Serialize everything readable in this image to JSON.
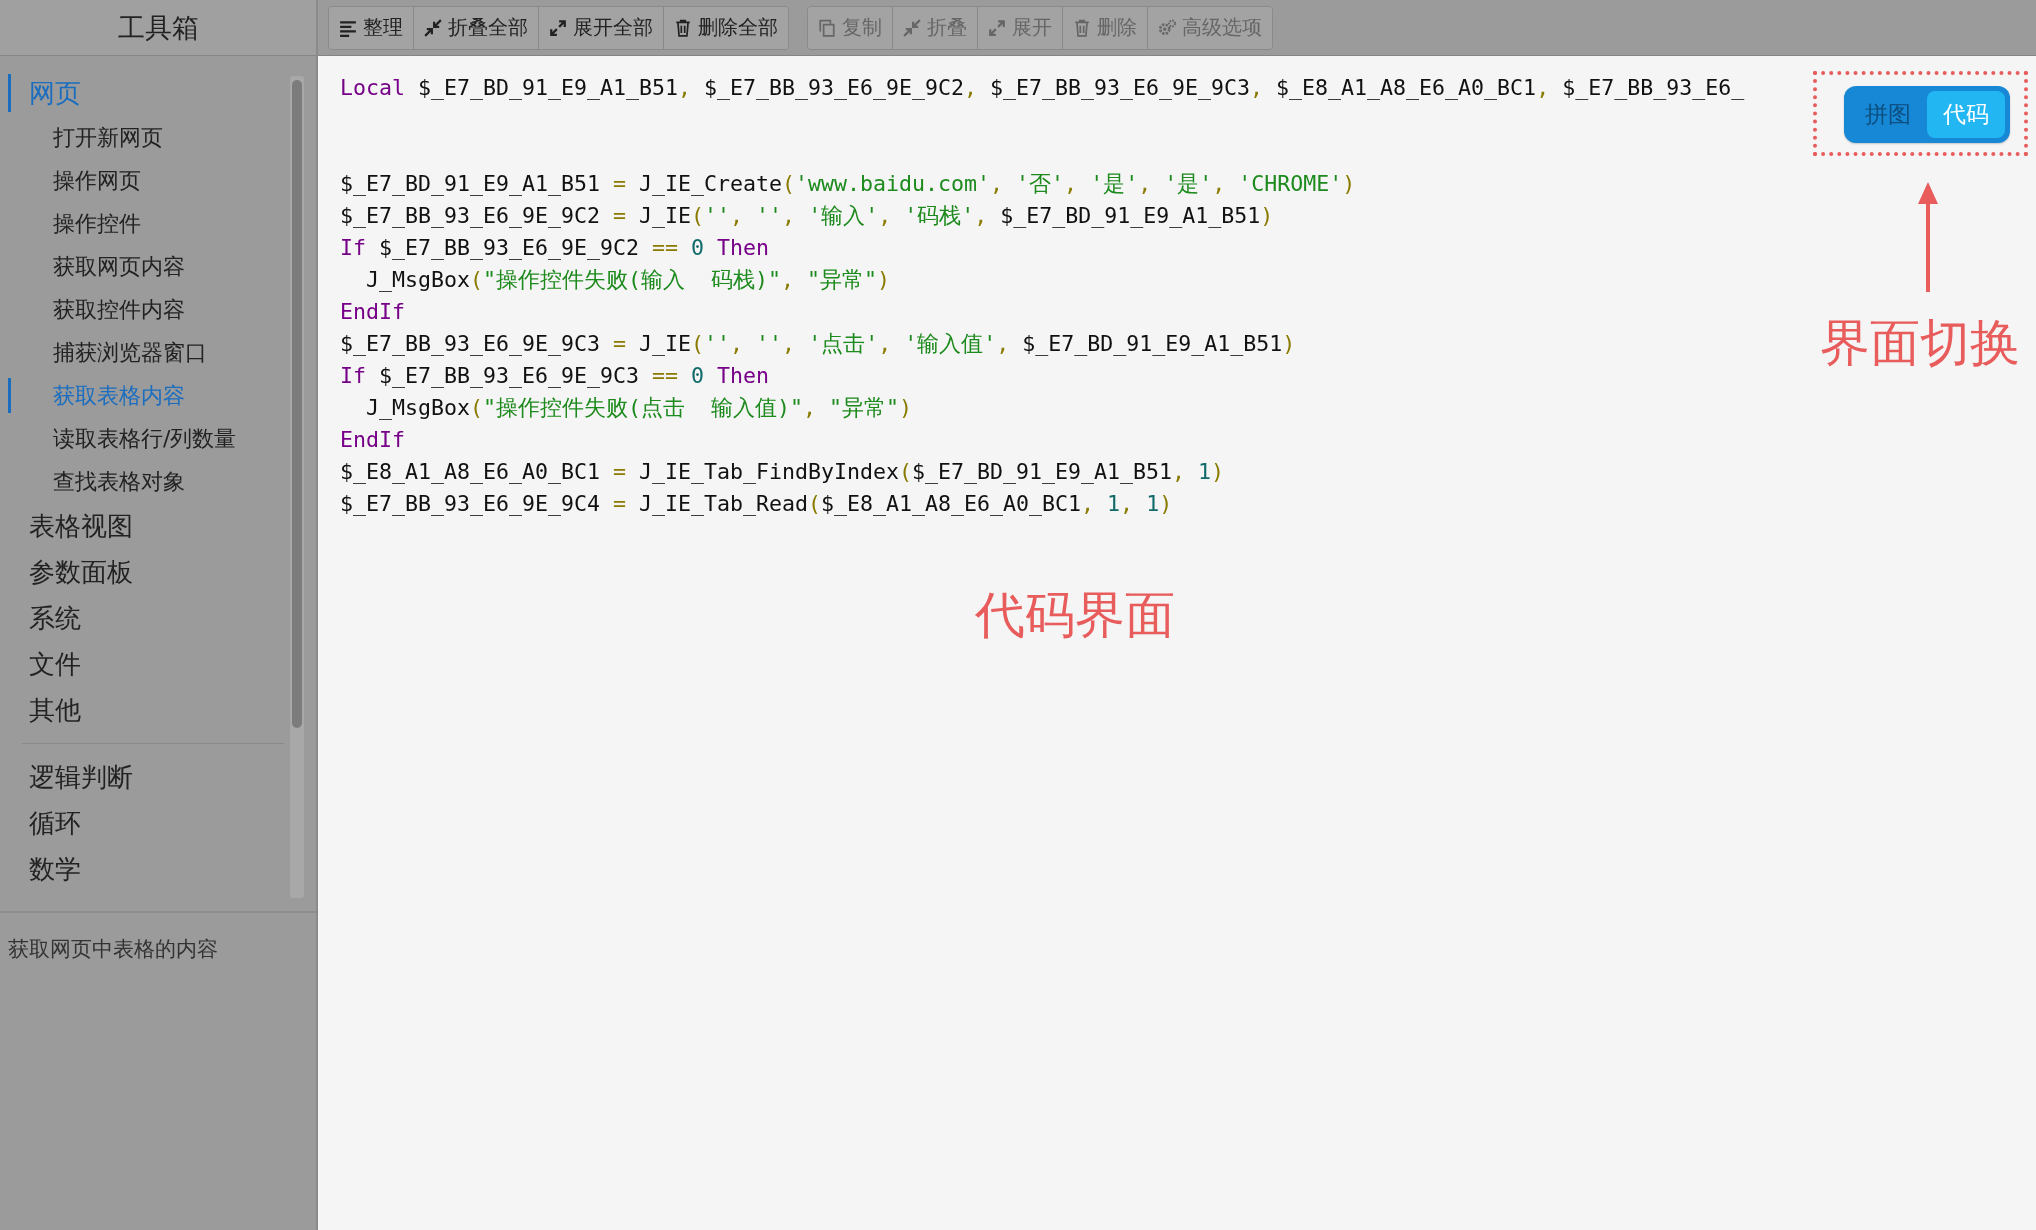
{
  "sidebar": {
    "title": "工具箱",
    "groups": [
      {
        "items": [
          {
            "label": "网页",
            "selected": true,
            "children": [
              {
                "label": "打开新网页",
                "selected": false
              },
              {
                "label": "操作网页",
                "selected": false
              },
              {
                "label": "操作控件",
                "selected": false
              },
              {
                "label": "获取网页内容",
                "selected": false
              },
              {
                "label": "获取控件内容",
                "selected": false
              },
              {
                "label": "捕获浏览器窗口",
                "selected": false
              },
              {
                "label": "获取表格内容",
                "selected": true
              },
              {
                "label": "读取表格行/列数量",
                "selected": false
              },
              {
                "label": "查找表格对象",
                "selected": false
              }
            ]
          },
          {
            "label": "表格视图",
            "selected": false
          },
          {
            "label": "参数面板",
            "selected": false
          },
          {
            "label": "系统",
            "selected": false
          },
          {
            "label": "文件",
            "selected": false
          },
          {
            "label": "其他",
            "selected": false
          }
        ]
      },
      {
        "items": [
          {
            "label": "逻辑判断",
            "selected": false
          },
          {
            "label": "循环",
            "selected": false
          },
          {
            "label": "数学",
            "selected": false
          }
        ]
      }
    ],
    "description": "获取网页中表格的内容"
  },
  "toolbar": {
    "groups": [
      {
        "buttons": [
          {
            "label": "整理",
            "kind": "align",
            "disabled": false
          },
          {
            "label": "折叠全部",
            "kind": "collapse",
            "disabled": false
          },
          {
            "label": "展开全部",
            "kind": "expand",
            "disabled": false
          },
          {
            "label": "删除全部",
            "kind": "trash",
            "disabled": false
          }
        ]
      },
      {
        "buttons": [
          {
            "label": "复制",
            "kind": "copy",
            "disabled": true
          },
          {
            "label": "折叠",
            "kind": "collapse",
            "disabled": true
          },
          {
            "label": "展开",
            "kind": "expand",
            "disabled": true
          },
          {
            "label": "删除",
            "kind": "trash",
            "disabled": true
          },
          {
            "label": "高级选项",
            "kind": "gears",
            "disabled": true
          }
        ]
      }
    ]
  },
  "view_toggle": [
    {
      "label": "拼图",
      "selected": false
    },
    {
      "label": "代码",
      "selected": true
    }
  ],
  "code": {
    "declaration": [
      {
        "kind": "kw",
        "text": "Local"
      },
      {
        "kind": "var",
        "text": " $_E7_BD_91_E9_A1_B51"
      },
      {
        "kind": "op",
        "text": ","
      },
      {
        "kind": "var",
        "text": " $_E7_BB_93_E6_9E_9C2"
      },
      {
        "kind": "op",
        "text": ","
      },
      {
        "kind": "var",
        "text": " $_E7_BB_93_E6_9E_9C3"
      },
      {
        "kind": "op",
        "text": ","
      },
      {
        "kind": "var",
        "text": " $_E8_A1_A8_E6_A0_BC1"
      },
      {
        "kind": "op",
        "text": ","
      },
      {
        "kind": "var",
        "text": " $_E7_BB_93_E6_"
      }
    ],
    "lines": [
      [
        {
          "kind": "var",
          "text": "$_E7_BD_91_E9_A1_B51"
        },
        {
          "kind": "op",
          "text": " = "
        },
        {
          "kind": "var",
          "text": "J_IE_Create"
        },
        {
          "kind": "op",
          "text": "("
        },
        {
          "kind": "str",
          "text": "'www.baidu.com'"
        },
        {
          "kind": "op",
          "text": ", "
        },
        {
          "kind": "str",
          "text": "'否'"
        },
        {
          "kind": "op",
          "text": ", "
        },
        {
          "kind": "str",
          "text": "'是'"
        },
        {
          "kind": "op",
          "text": ", "
        },
        {
          "kind": "str",
          "text": "'是'"
        },
        {
          "kind": "op",
          "text": ", "
        },
        {
          "kind": "str",
          "text": "'CHROME'"
        },
        {
          "kind": "op",
          "text": ")"
        }
      ],
      [
        {
          "kind": "var",
          "text": "$_E7_BB_93_E6_9E_9C2"
        },
        {
          "kind": "op",
          "text": " = "
        },
        {
          "kind": "var",
          "text": "J_IE"
        },
        {
          "kind": "op",
          "text": "("
        },
        {
          "kind": "str",
          "text": "''"
        },
        {
          "kind": "op",
          "text": ", "
        },
        {
          "kind": "str",
          "text": "''"
        },
        {
          "kind": "op",
          "text": ", "
        },
        {
          "kind": "str",
          "text": "'输入'"
        },
        {
          "kind": "op",
          "text": ", "
        },
        {
          "kind": "str",
          "text": "'码栈'"
        },
        {
          "kind": "op",
          "text": ", "
        },
        {
          "kind": "var",
          "text": "$_E7_BD_91_E9_A1_B51"
        },
        {
          "kind": "op",
          "text": ")"
        }
      ],
      [
        {
          "kind": "kw",
          "text": "If"
        },
        {
          "kind": "var",
          "text": " $_E7_BB_93_E6_9E_9C2"
        },
        {
          "kind": "op",
          "text": " == "
        },
        {
          "kind": "num",
          "text": "0"
        },
        {
          "kind": "kw",
          "text": " Then"
        }
      ],
      [
        {
          "kind": "var",
          "text": "  J_MsgBox"
        },
        {
          "kind": "op",
          "text": "("
        },
        {
          "kind": "str",
          "text": "\"操作控件失败(输入  码栈)\""
        },
        {
          "kind": "op",
          "text": ", "
        },
        {
          "kind": "str",
          "text": "\"异常\""
        },
        {
          "kind": "op",
          "text": ")"
        }
      ],
      [
        {
          "kind": "kw",
          "text": "EndIf"
        }
      ],
      [
        {
          "kind": "var",
          "text": "$_E7_BB_93_E6_9E_9C3"
        },
        {
          "kind": "op",
          "text": " = "
        },
        {
          "kind": "var",
          "text": "J_IE"
        },
        {
          "kind": "op",
          "text": "("
        },
        {
          "kind": "str",
          "text": "''"
        },
        {
          "kind": "op",
          "text": ", "
        },
        {
          "kind": "str",
          "text": "''"
        },
        {
          "kind": "op",
          "text": ", "
        },
        {
          "kind": "str",
          "text": "'点击'"
        },
        {
          "kind": "op",
          "text": ", "
        },
        {
          "kind": "str",
          "text": "'输入值'"
        },
        {
          "kind": "op",
          "text": ", "
        },
        {
          "kind": "var",
          "text": "$_E7_BD_91_E9_A1_B51"
        },
        {
          "kind": "op",
          "text": ")"
        }
      ],
      [
        {
          "kind": "kw",
          "text": "If"
        },
        {
          "kind": "var",
          "text": " $_E7_BB_93_E6_9E_9C3"
        },
        {
          "kind": "op",
          "text": " == "
        },
        {
          "kind": "num",
          "text": "0"
        },
        {
          "kind": "kw",
          "text": " Then"
        }
      ],
      [
        {
          "kind": "var",
          "text": "  J_MsgBox"
        },
        {
          "kind": "op",
          "text": "("
        },
        {
          "kind": "str",
          "text": "\"操作控件失败(点击  输入值)\""
        },
        {
          "kind": "op",
          "text": ", "
        },
        {
          "kind": "str",
          "text": "\"异常\""
        },
        {
          "kind": "op",
          "text": ")"
        }
      ],
      [
        {
          "kind": "kw",
          "text": "EndIf"
        }
      ],
      [
        {
          "kind": "var",
          "text": "$_E8_A1_A8_E6_A0_BC1"
        },
        {
          "kind": "op",
          "text": " = "
        },
        {
          "kind": "var",
          "text": "J_IE_Tab_FindByIndex"
        },
        {
          "kind": "op",
          "text": "("
        },
        {
          "kind": "var",
          "text": "$_E7_BD_91_E9_A1_B51"
        },
        {
          "kind": "op",
          "text": ", "
        },
        {
          "kind": "num",
          "text": "1"
        },
        {
          "kind": "op",
          "text": ")"
        }
      ],
      [
        {
          "kind": "var",
          "text": "$_E7_BB_93_E6_9E_9C4"
        },
        {
          "kind": "op",
          "text": " = "
        },
        {
          "kind": "var",
          "text": "J_IE_Tab_Read"
        },
        {
          "kind": "op",
          "text": "("
        },
        {
          "kind": "var",
          "text": "$_E8_A1_A8_E6_A0_BC1"
        },
        {
          "kind": "op",
          "text": ", "
        },
        {
          "kind": "num",
          "text": "1"
        },
        {
          "kind": "op",
          "text": ", "
        },
        {
          "kind": "num",
          "text": "1"
        },
        {
          "kind": "op",
          "text": ")"
        }
      ]
    ]
  },
  "annotations": [
    {
      "kind": "switch",
      "text": "界面切换"
    },
    {
      "kind": "view",
      "text": "代码界面"
    }
  ]
}
